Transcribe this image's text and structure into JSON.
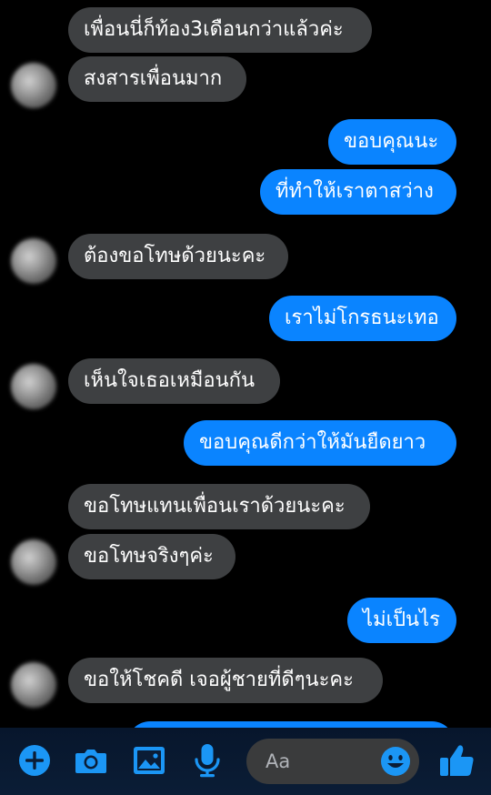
{
  "messages": [
    {
      "side": "in",
      "text": "เพื่อนนี่ก็ท้อง3เดือนกว่าแล้วค่ะ"
    },
    {
      "side": "in",
      "text": "สงสารเพื่อนมาก"
    },
    {
      "side": "out",
      "text": "ขอบคุณนะ"
    },
    {
      "side": "out",
      "text": "ที่ทำให้เราตาสว่าง"
    },
    {
      "side": "in",
      "text": "ต้องขอโทษด้วยนะคะ"
    },
    {
      "side": "out",
      "text": "เราไม่โกรธนะเทอ"
    },
    {
      "side": "in",
      "text": "เห็นใจเธอเหมือนกัน"
    },
    {
      "side": "out",
      "text": "ขอบคุณดีกว่าให้มันยืดยาว"
    },
    {
      "side": "in",
      "text": "ขอโทษแทนเพื่อนเราด้วยนะคะ"
    },
    {
      "side": "in",
      "text": "ขอโทษจริงๆค่ะ"
    },
    {
      "side": "out",
      "text": "ไม่เป็นไร"
    },
    {
      "side": "in",
      "text": "ขอให้โชคดี เจอผู้ชายที่ดีๆนะคะ"
    }
  ],
  "composer": {
    "placeholder": "Aa",
    "icons": [
      "plus-icon",
      "camera-icon",
      "image-icon",
      "microphone-icon",
      "emoji-icon",
      "thumbs-up-icon"
    ],
    "accent_color": "#1b96f5"
  },
  "colors": {
    "incoming_bubble": "#3e4042",
    "outgoing_bubble": "#0a84ff",
    "background": "#000000"
  }
}
